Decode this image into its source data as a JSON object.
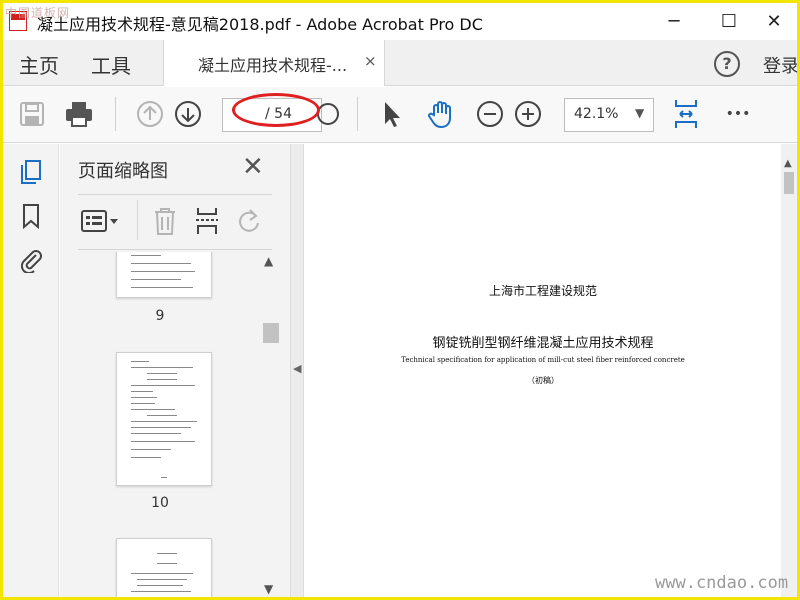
{
  "window": {
    "title": "凝土应用技术规程-意见稿2018.pdf - Adobe Acrobat Pro DC",
    "minimize": "─",
    "maximize": "☐",
    "close": "✕",
    "watermark_top": "中国道板网"
  },
  "tabs": {
    "home": "主页",
    "tools": "工具",
    "document": "凝土应用技术规程-...",
    "document_close": "×",
    "help": "?",
    "login": "登录"
  },
  "toolbar": {
    "page_current": "",
    "page_total": "/ 54",
    "zoom": "42.1%",
    "zoom_caret": "▼",
    "more": "•••"
  },
  "thumbnails_panel": {
    "title": "页面缩略图",
    "close": "✕",
    "pages": [
      {
        "number": "9"
      },
      {
        "number": "10"
      },
      {
        "number": ""
      }
    ]
  },
  "document": {
    "line1": "上海市工程建设规范",
    "line2": "钢锭铣削型钢纤维混凝土应用技术规程",
    "line3": "Technical specification for application of mill-cut steel fiber reinforced concrete",
    "line4": "（初稿）"
  },
  "watermark_bottom": "www.cndao.com",
  "colors": {
    "accent_blue": "#1a6fc4",
    "highlight_oval": "#e02020",
    "frame_border": "#f2e600"
  }
}
